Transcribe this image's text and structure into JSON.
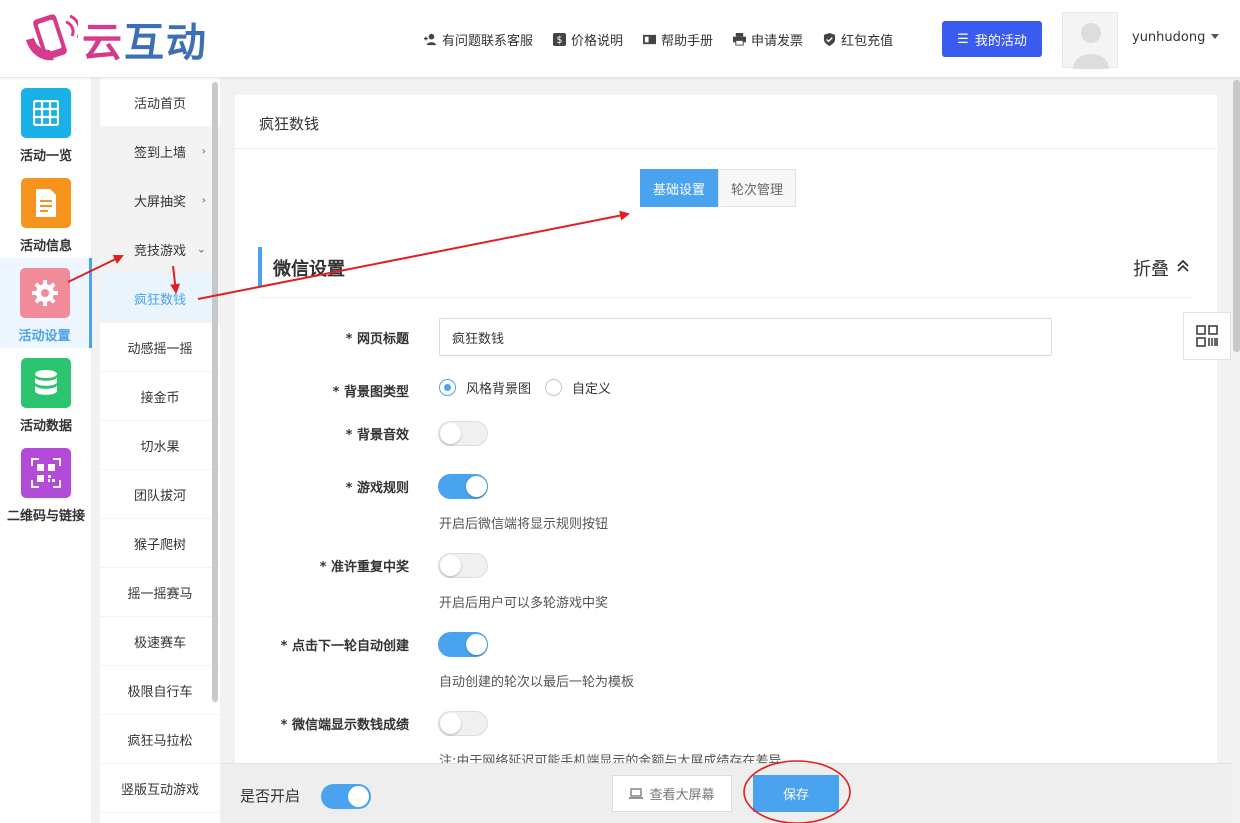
{
  "header": {
    "logo_text_1": "云",
    "logo_text_2": "互动",
    "nav": [
      {
        "label": "有问题联系客服",
        "icon": "user-plus-icon"
      },
      {
        "label": "价格说明",
        "icon": "dollar-icon"
      },
      {
        "label": "帮助手册",
        "icon": "book-icon"
      },
      {
        "label": "申请发票",
        "icon": "printer-icon"
      },
      {
        "label": "红包充值",
        "icon": "shield-icon"
      }
    ],
    "my_activity": "我的活动",
    "username": "yunhudong"
  },
  "sidebar1": [
    {
      "label": "活动一览",
      "color": "#1ab0e8",
      "icon": "grid-icon"
    },
    {
      "label": "活动信息",
      "color": "#f7941d",
      "icon": "document-icon"
    },
    {
      "label": "活动设置",
      "color": "#f08b97",
      "icon": "gear-icon"
    },
    {
      "label": "活动数据",
      "color": "#2cc46e",
      "icon": "database-icon"
    },
    {
      "label": "二维码与链接",
      "color": "#b44bd8",
      "icon": "qrcode-icon"
    }
  ],
  "sidebar2": [
    {
      "label": "活动首页",
      "chev": ""
    },
    {
      "label": "签到上墙",
      "chev": "›"
    },
    {
      "label": "大屏抽奖",
      "chev": "›"
    },
    {
      "label": "竞技游戏",
      "chev": "⌄"
    },
    {
      "label": "疯狂数钱",
      "chev": ""
    },
    {
      "label": "动感摇一摇",
      "chev": ""
    },
    {
      "label": "接金币",
      "chev": ""
    },
    {
      "label": "切水果",
      "chev": ""
    },
    {
      "label": "团队拔河",
      "chev": ""
    },
    {
      "label": "猴子爬树",
      "chev": ""
    },
    {
      "label": "摇一摇赛马",
      "chev": ""
    },
    {
      "label": "极速赛车",
      "chev": ""
    },
    {
      "label": "极限自行车",
      "chev": ""
    },
    {
      "label": "疯狂马拉松",
      "chev": ""
    },
    {
      "label": "竖版互动游戏",
      "chev": ""
    }
  ],
  "panel": {
    "title": "疯狂数钱",
    "tabs": [
      "基础设置",
      "轮次管理"
    ],
    "section_title": "微信设置",
    "fold_label": "折叠",
    "fields": {
      "page_title_label": "* 网页标题",
      "page_title_value": "疯狂数钱",
      "bg_type_label": "* 背景图类型",
      "bg_type_options": [
        "风格背景图",
        "自定义"
      ],
      "bg_sound_label": "* 背景音效",
      "game_rules_label": "* 游戏规则",
      "game_rules_hint": "开启后微信端将显示规则按钮",
      "repeat_win_label": "* 准许重复中奖",
      "repeat_win_hint": "开启后用户可以多轮游戏中奖",
      "auto_create_label": "* 点击下一轮自动创建",
      "auto_create_hint": "自动创建的轮次以最后一轮为模板",
      "show_score_label": "* 微信端显示数钱成绩",
      "show_score_hint": "注:由于网络延迟可能手机端显示的金额与大屏成绩存在差异"
    }
  },
  "footer": {
    "enable_label": "是否开启",
    "view_screen": "查看大屏幕",
    "save": "保存"
  },
  "colors": {
    "accent": "#4aa3ee",
    "primary_button": "#3a5bf0",
    "annotation": "#e02020"
  }
}
